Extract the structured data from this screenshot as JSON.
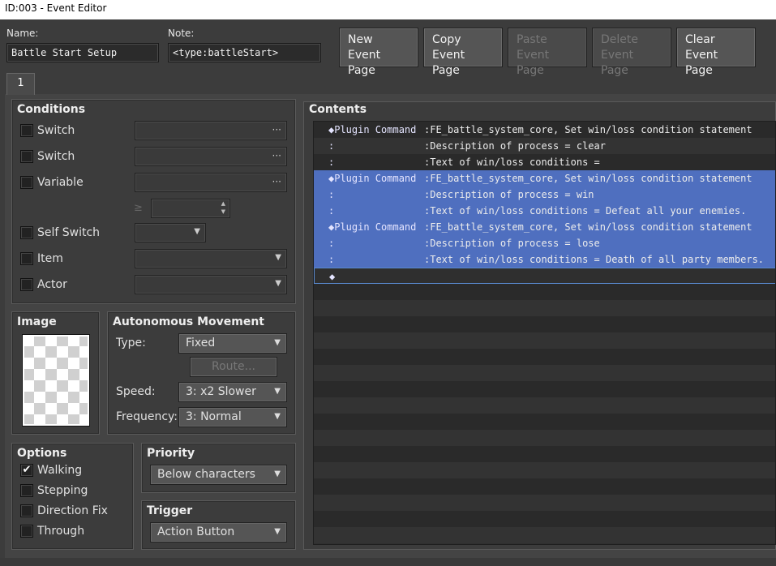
{
  "window": {
    "title": "ID:003 - Event Editor"
  },
  "header": {
    "name_label": "Name:",
    "name_value": "Battle Start Setup",
    "note_label": "Note:",
    "note_value": "<type:battleStart>"
  },
  "toolbar": {
    "new": [
      "New",
      "Event Page"
    ],
    "copy": [
      "Copy",
      "Event Page"
    ],
    "paste": [
      "Paste",
      "Event Page"
    ],
    "delete": [
      "Delete",
      "Event Page"
    ],
    "clear": [
      "Clear",
      "Event Page"
    ]
  },
  "tabs": [
    {
      "label": "1"
    }
  ],
  "conditions": {
    "title": "Conditions",
    "switch1": "Switch",
    "switch2": "Switch",
    "variable": "Variable",
    "ge_symbol": "≥",
    "self_switch": "Self Switch",
    "item": "Item",
    "actor": "Actor",
    "dots": "···"
  },
  "image": {
    "title": "Image"
  },
  "movement": {
    "title": "Autonomous Movement",
    "type_label": "Type:",
    "type_value": "Fixed",
    "route_label": "Route...",
    "speed_label": "Speed:",
    "speed_value": "3: x2 Slower",
    "frequency_label": "Frequency:",
    "frequency_value": "3: Normal"
  },
  "options": {
    "title": "Options",
    "walking": "Walking",
    "walking_checked": "✔",
    "stepping": "Stepping",
    "direction_fix": "Direction Fix",
    "through": "Through"
  },
  "priority": {
    "title": "Priority",
    "value": "Below characters"
  },
  "trigger": {
    "title": "Trigger",
    "value": "Action Button"
  },
  "contents": {
    "title": "Contents",
    "rows": [
      {
        "c1": "◆Plugin Command",
        "c2": ":FE_battle_system_core, Set win/loss condition statement"
      },
      {
        "c1": " :",
        "c2": ":Description of process = clear"
      },
      {
        "c1": " :",
        "c2": ":Text of win/loss conditions ="
      },
      {
        "c1": "◆Plugin Command",
        "c2": ":FE_battle_system_core, Set win/loss condition statement"
      },
      {
        "c1": " :",
        "c2": ":Description of process = win"
      },
      {
        "c1": " :",
        "c2": ":Text of win/loss conditions = Defeat all your enemies."
      },
      {
        "c1": "◆Plugin Command",
        "c2": ":FE_battle_system_core, Set win/loss condition statement"
      },
      {
        "c1": " :",
        "c2": ":Description of process = lose"
      },
      {
        "c1": " :",
        "c2": ":Text of win/loss conditions = Death of all party members."
      },
      {
        "c1": "◆",
        "c2": ""
      }
    ]
  }
}
